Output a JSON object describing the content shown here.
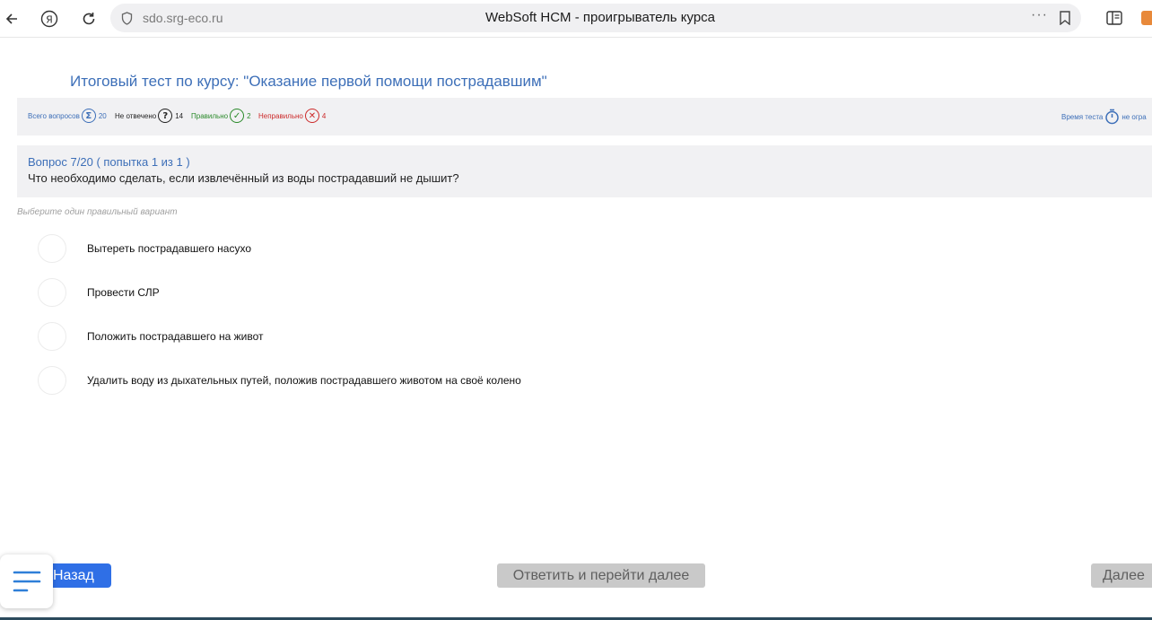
{
  "browser": {
    "url": "sdo.srg-eco.ru",
    "page_title": "WebSoft HCM - проигрыватель курса",
    "more_label": "···",
    "icons": [
      "back-arrow-icon",
      "yandex-icon",
      "reload-icon",
      "shield-icon",
      "bookmark-icon",
      "sidebar-icon",
      "extension-icon"
    ]
  },
  "course": {
    "title": "Итоговый тест по курсу: \"Оказание первой помощи пострадавшим\""
  },
  "stats": {
    "total_label": "Всего вопросов",
    "total_value": "20",
    "unanswered_label": "Не отвечено",
    "unanswered_value": "14",
    "correct_label": "Правильно",
    "correct_value": "2",
    "wrong_label": "Неправильно",
    "wrong_value": "4",
    "timer_label": "Время теста",
    "timer_value": "не огра",
    "colors": {
      "total": "#3d6fb8",
      "unanswered": "#222222",
      "correct": "#2a8a2a",
      "wrong": "#cc2a2a"
    }
  },
  "question": {
    "number": "Вопрос 7/20",
    "attempt": "( попытка 1 из 1 )",
    "text": "Что необходимо сделать, если извлечённый из воды пострадавший не дышит?",
    "hint": "Выберите один правильный вариант",
    "options": [
      "Вытереть пострадавшего насухо",
      "Провести СЛР",
      "Положить пострадавшего на живот",
      "Удалить воду из дыхательных путей, положив пострадавшего животом на своё колено"
    ]
  },
  "footer": {
    "back_label": "Назад",
    "answer_label": "Ответить и перейти далее",
    "next_label": "Далее"
  },
  "colors": {
    "accent": "#2f6fe6",
    "title_blue": "#3d6fb8",
    "panel_bg": "#f1f1f3",
    "disabled_btn": "#c9c9c9"
  }
}
